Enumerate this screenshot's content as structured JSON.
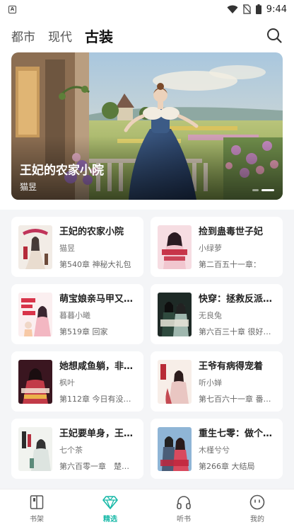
{
  "status_bar": {
    "time": "9:44"
  },
  "top_tabs": [
    {
      "label": "都市",
      "active": false
    },
    {
      "label": "现代",
      "active": false
    },
    {
      "label": "古装",
      "active": true
    }
  ],
  "banner": {
    "title": "王妃的农家小院",
    "author": "猫昱"
  },
  "books": [
    {
      "title": "王妃的农家小院",
      "author": "猫昱",
      "chapter": "第540章 神秘大礼包"
    },
    {
      "title": "捡到蛊毒世子妃",
      "author": "小绿萝",
      "chapter": "第二百五十一章："
    },
    {
      "title": "萌宝娘亲马甲又…",
      "author": "暮暮小曦",
      "chapter": "第519章 回家"
    },
    {
      "title": "快穿：拯救反派…",
      "author": "无良兔",
      "chapter": "第六百三十章 很好…"
    },
    {
      "title": "她想咸鱼躺，非…",
      "author": "枫叶",
      "chapter": "第112章 今日有没…"
    },
    {
      "title": "王爷有病得宠着",
      "author": "听小婵",
      "chapter": "第七百六十一章 番…"
    },
    {
      "title": "王妃要单身，王…",
      "author": "七个茶",
      "chapter": "第六百零一章　楚…"
    },
    {
      "title": "重生七零：做个…",
      "author": "木槿兮兮",
      "chapter": "第266章 大结局"
    }
  ],
  "bottom_nav": [
    {
      "label": "书架",
      "icon": "bookshelf-icon",
      "active": false
    },
    {
      "label": "精选",
      "icon": "diamond-icon",
      "active": true
    },
    {
      "label": "听书",
      "icon": "headphones-icon",
      "active": false
    },
    {
      "label": "我的",
      "icon": "profile-face-icon",
      "active": false
    }
  ],
  "colors": {
    "accent": "#18b9a8",
    "background": "#f4f5f7"
  }
}
